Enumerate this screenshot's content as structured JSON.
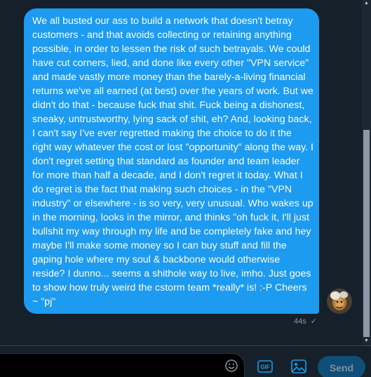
{
  "conversation": {
    "message": {
      "text": "We all busted our ass to build a network that doesn't betray customers - and that avoids collecting or retaining anything possible, in order to lessen the risk of such betrayals. We could have cut corners, lied, and done like every other \"VPN service\" and made vastly more money than the barely-a-living financial returns we've all earned (at best) over the years of work. But we didn't do that - because fuck that shit. Fuck being a dishonest, sneaky, untrustworthy, lying sack of shit, eh? And, looking back, I can't say I've ever regretted making the choice to do it the right way whatever the cost or lost \"opportunity\" along the way. I don't regret setting that standard as founder and team leader for more than half a decade, and I don't regret it today. What I do regret is the fact that making such choices - in the \"VPN industry\" or elsewhere - is so very, very unusual. Who wakes up in the morning, looks in the mirror, and thinks \"oh fuck it, I'll just bullshit my way through my life and be completely fake and hey maybe I'll make some money so I can buy stuff and fill the gaping hole where my soul & backbone would otherwise reside? I dunno... seems a shithole way to live, imho. Just goes to show how truly weird the cstorm team *really* is! :-P Cheers ~ \"pj\"",
      "timestamp": "44s",
      "status_icon": "check-icon",
      "bubble_color": "#1d9bf0"
    }
  },
  "composer": {
    "input_value": "",
    "placeholder": "",
    "emoji_icon": "emoji-icon",
    "gif_label": "GIF",
    "image_icon": "image-icon",
    "send_label": "Send"
  },
  "colors": {
    "background": "#15202b",
    "accent": "#1d9bf0",
    "muted": "#8b98a5",
    "send_disabled_bg": "#0f4e78"
  }
}
